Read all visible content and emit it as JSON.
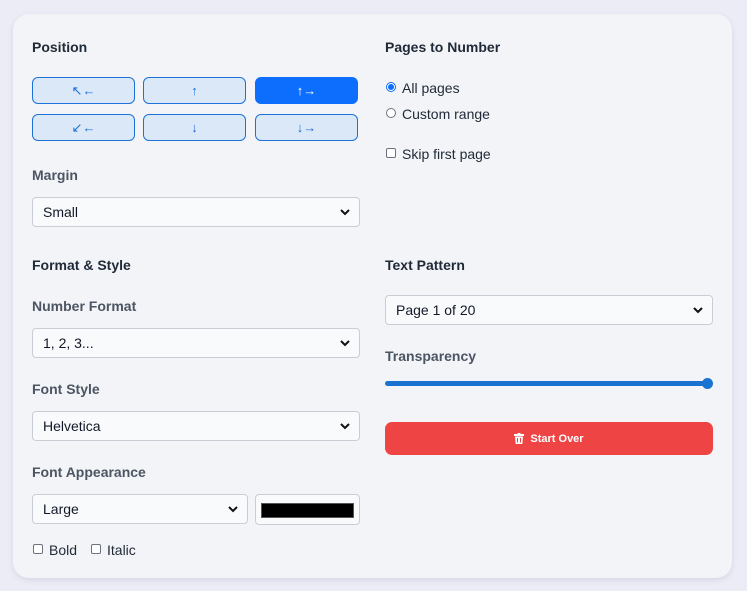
{
  "position": {
    "title": "Position",
    "buttons": [
      {
        "glyph": "↖←",
        "name": "top-left"
      },
      {
        "glyph": "↑",
        "name": "top-center"
      },
      {
        "glyph": "↑→",
        "name": "top-right"
      },
      {
        "glyph": "↙←",
        "name": "bottom-left"
      },
      {
        "glyph": "↓",
        "name": "bottom-center"
      },
      {
        "glyph": "↓→",
        "name": "bottom-right"
      }
    ],
    "selected": "top-right",
    "margin_label": "Margin",
    "margin_value": "Small"
  },
  "pages": {
    "title": "Pages to Number",
    "all_pages": "All pages",
    "custom_range": "Custom range",
    "skip_first": "Skip first page",
    "selected": "All pages"
  },
  "format": {
    "title": "Format & Style",
    "number_format_label": "Number Format",
    "number_format_value": "1, 2, 3...",
    "font_style_label": "Font Style",
    "font_style_value": "Helvetica",
    "font_appearance_label": "Font Appearance",
    "font_size_value": "Large",
    "font_color": "#000000",
    "bold_label": "Bold",
    "italic_label": "Italic"
  },
  "text_pattern": {
    "title": "Text Pattern",
    "value": "Page 1 of 20",
    "transparency_label": "Transparency",
    "transparency_value": 1.0
  },
  "actions": {
    "start_over_label": "Start Over"
  },
  "colors": {
    "accent": "#0d6efd",
    "danger": "#ef4444"
  }
}
